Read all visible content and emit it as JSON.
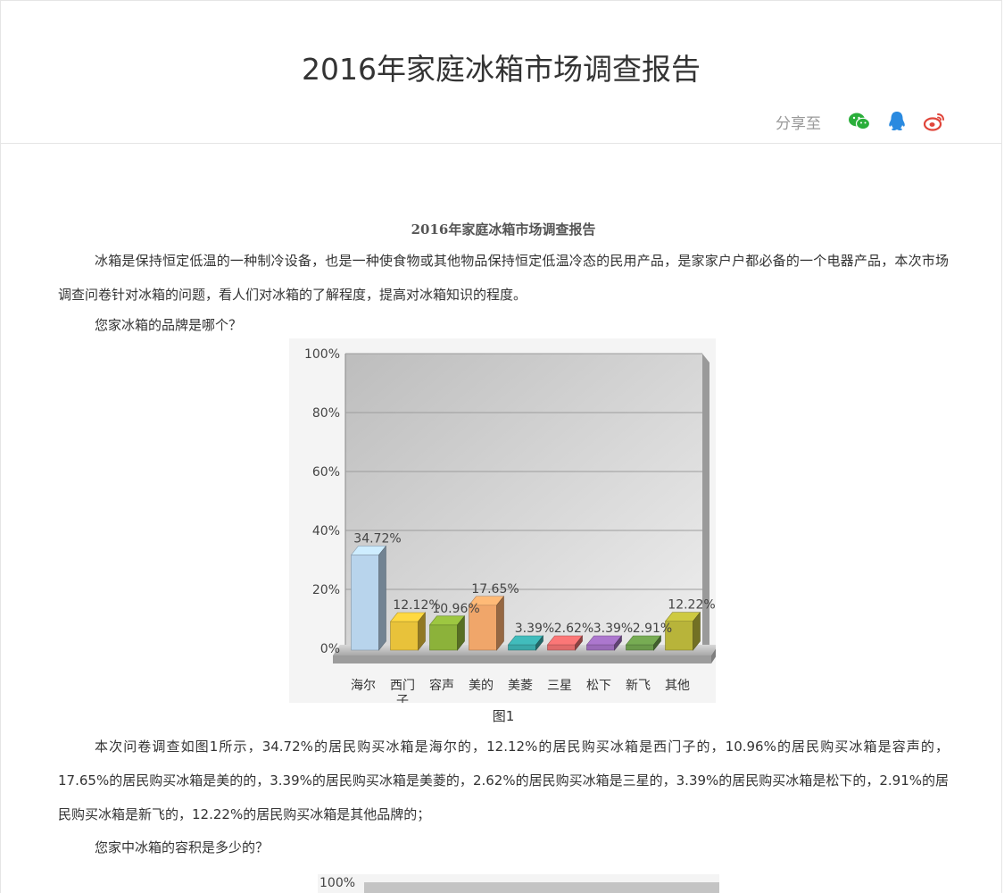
{
  "header": {
    "title": "2016年家庭冰箱市场调查报告",
    "share_label": "分享至",
    "share_icons": [
      "wechat-icon",
      "qq-icon",
      "weibo-icon"
    ]
  },
  "article": {
    "title": "2016年家庭冰箱市场调查报告",
    "intro": "冰箱是保持恒定低温的一种制冷设备，也是一种使食物或其他物品保持恒定低温冷态的民用产品，是家家户户都必备的一个电器产品，本次市场调查问卷针对冰箱的问题，看人们对冰箱的了解程度，提高对冰箱知识的程度。",
    "question1": "您家冰箱的品牌是哪个？",
    "caption1": "图1",
    "analysis1": "本次问卷调查如图1所示，34.72%的居民购买冰箱是海尔的，12.12%的居民购买冰箱是西门子的，10.96%的居民购买冰箱是容声的，17.65%的居民购买冰箱是美的的，3.39%的居民购买冰箱是美菱的，2.62%的居民购买冰箱是三星的，3.39%的居民购买冰箱是松下的，2.91%的居民购买冰箱是新飞的，12.22%的居民购买冰箱是其他品牌的；",
    "question2": "您家中冰箱的容积是多少的？"
  },
  "chart_data": [
    {
      "type": "bar",
      "categories": [
        "海尔",
        "西门子",
        "容声",
        "美的",
        "美菱",
        "三星",
        "松下",
        "新飞",
        "其他"
      ],
      "values": [
        34.72,
        12.12,
        10.96,
        17.65,
        3.39,
        2.62,
        3.39,
        2.91,
        12.22
      ],
      "value_labels": [
        "34.72%",
        "12.12%",
        "10.96%",
        "17.65%",
        "3.39%",
        "2.62%",
        "3.39%",
        "2.91%",
        "12.22%"
      ],
      "yticks": [
        "100%",
        "80%",
        "60%",
        "40%",
        "20%",
        "0%"
      ],
      "ylim": [
        0,
        100
      ],
      "grid": true,
      "bar_colors": [
        "#b8d4ec",
        "#e8c23a",
        "#8cb23a",
        "#f0a66a",
        "#3aa8a8",
        "#e06a6a",
        "#9a6ab8",
        "#6a9a4a",
        "#b8b43a"
      ]
    },
    {
      "type": "bar",
      "yticks": [
        "100%"
      ]
    }
  ]
}
